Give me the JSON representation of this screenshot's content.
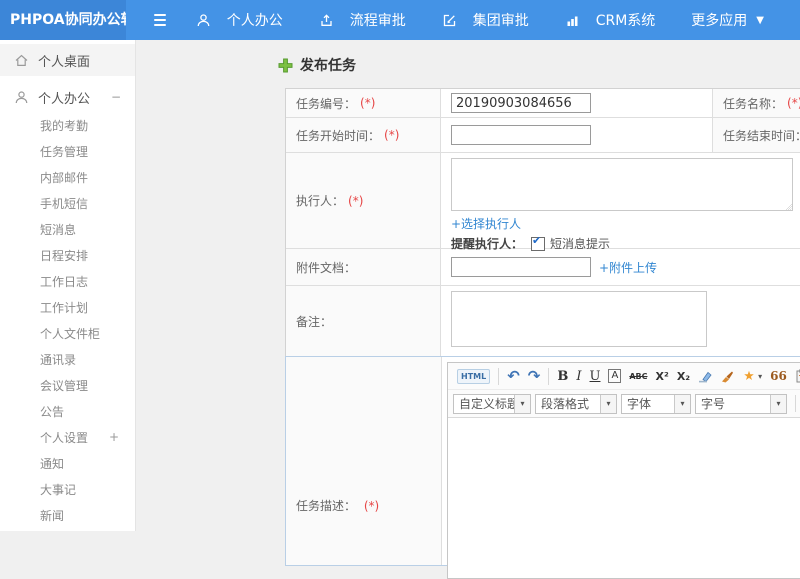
{
  "header": {
    "logo": "PHPOA协同办公软件",
    "nav": [
      {
        "label": "个人办公"
      },
      {
        "label": "流程审批"
      },
      {
        "label": "集团审批"
      },
      {
        "label": "CRM系统"
      },
      {
        "label": "更多应用"
      }
    ]
  },
  "sidebar": {
    "items": [
      {
        "label": "个人桌面"
      },
      {
        "label": "个人办公",
        "toggle": "−"
      },
      {
        "label": "我的考勤"
      },
      {
        "label": "任务管理"
      },
      {
        "label": "内部邮件"
      },
      {
        "label": "手机短信"
      },
      {
        "label": "短消息"
      },
      {
        "label": "日程安排"
      },
      {
        "label": "工作日志"
      },
      {
        "label": "工作计划"
      },
      {
        "label": "个人文件柜"
      },
      {
        "label": "通讯录"
      },
      {
        "label": "会议管理"
      },
      {
        "label": "公告"
      },
      {
        "label": "个人设置",
        "toggle": "+"
      },
      {
        "label": "通知"
      },
      {
        "label": "大事记"
      },
      {
        "label": "新闻"
      }
    ]
  },
  "main": {
    "heading": "发布任务",
    "form": {
      "required_mark": "(*)",
      "task_number_label": "任务编号：",
      "task_number_value": "20190903084656",
      "task_name_label": "任务名称：",
      "start_time_label": "任务开始时间：",
      "end_time_label": "任务结束时间：",
      "executor_label": "执行人：",
      "choose_executor_link": "+选择执行人",
      "remind_executor_label": "提醒执行人：",
      "sms_tip_label": "短消息提示",
      "attachment_label": "附件文档：",
      "attachment_upload_link": "+附件上传",
      "remark_label": "备注：",
      "description_label": "任务描述："
    },
    "editor": {
      "html_button": "HTML",
      "undo_icon": "↶",
      "redo_icon": "↷",
      "bold": "B",
      "italic": "I",
      "underline": "U",
      "font_box": "A",
      "strike": "ABC",
      "superscript": "X²",
      "subscript": "X₂",
      "quote": "66",
      "font_color": "A",
      "caret": "▾",
      "selects": [
        {
          "label": "自定义标题"
        },
        {
          "label": "段落格式"
        },
        {
          "label": "字体"
        },
        {
          "label": "字号"
        }
      ]
    },
    "checkbox_check": "✔"
  },
  "colors": {
    "header_bg": "#4493e6",
    "logo_bg": "#3c86d8",
    "link_blue": "#3186d1",
    "required_red": "#e64545",
    "plus_green": "#7dc142"
  }
}
